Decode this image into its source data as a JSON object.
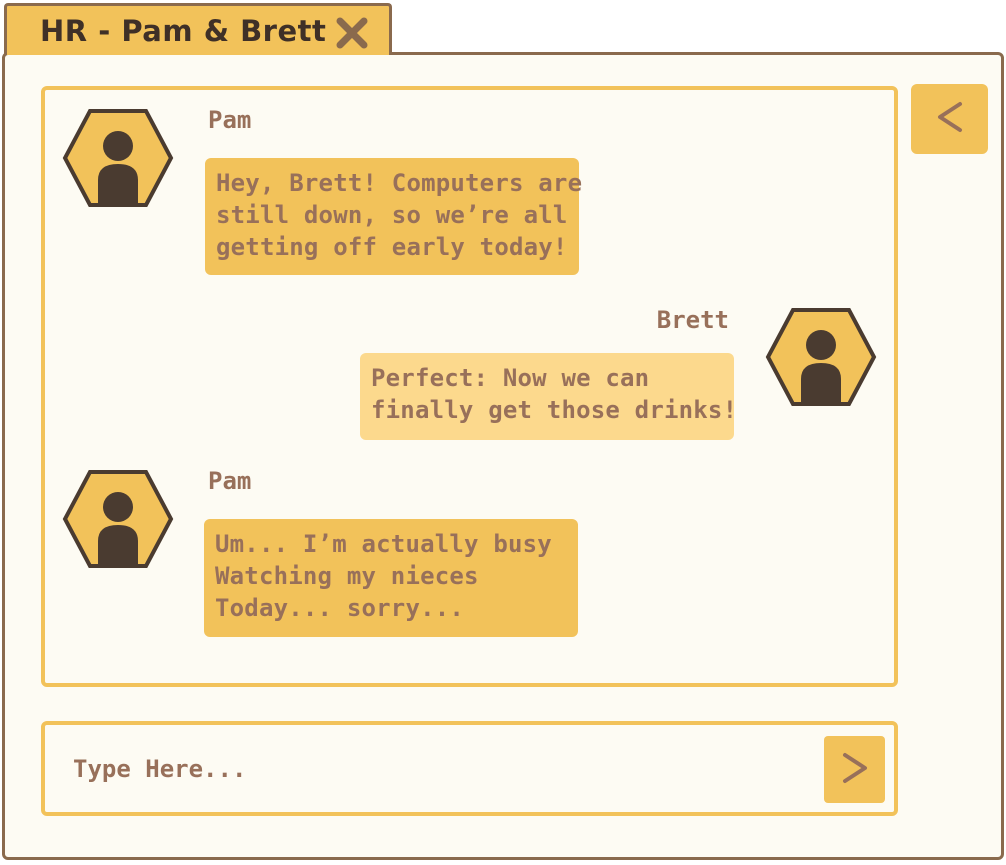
{
  "window": {
    "tab_title": "HR - Pam & Brett",
    "close_icon": "close-icon",
    "back_icon": "chevron-left-icon"
  },
  "colors": {
    "accent": "#f2c25a",
    "accent_light": "#fcd98d",
    "border": "#8a6a4d",
    "text": "#98705a",
    "dark": "#3f3027",
    "panel_bg": "#fdfbf3"
  },
  "messages": [
    {
      "sender": "Pam",
      "side": "left",
      "lines": [
        "Hey, Brett! Computers are",
        "still down, so we’re all",
        "getting off early today!"
      ]
    },
    {
      "sender": "Brett",
      "side": "right",
      "lines": [
        "Perfect: Now we can",
        "finally get those drinks!"
      ]
    },
    {
      "sender": "Pam",
      "side": "left",
      "lines": [
        "Um... I’m actually busy",
        "Watching my nieces",
        "Today... sorry..."
      ]
    }
  ],
  "composer": {
    "placeholder": "Type Here...",
    "value": "",
    "send_icon": "chevron-right-icon"
  }
}
